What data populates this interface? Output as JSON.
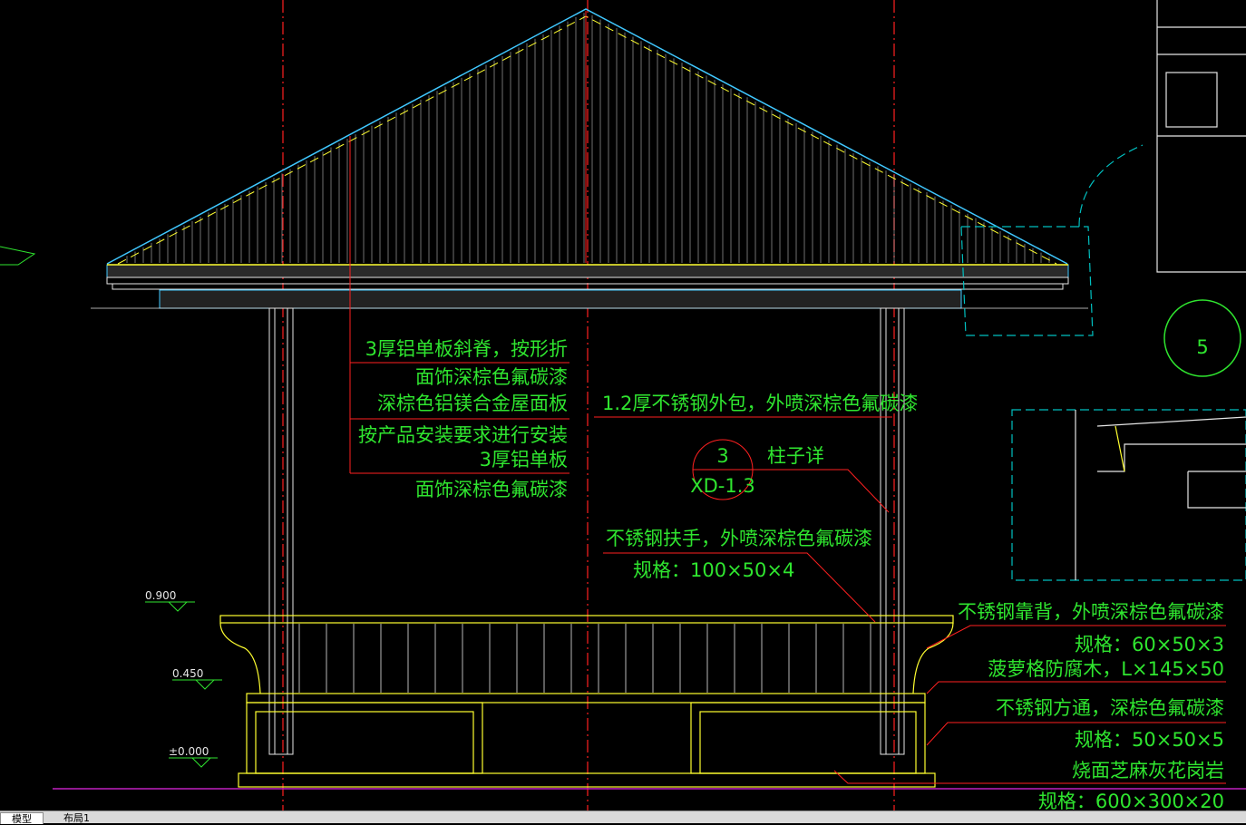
{
  "drawing": {
    "notes_left": [
      "3厚铝单板斜脊，按形折",
      "面饰深棕色氟碳漆",
      "深棕色铝镁合金屋面板",
      "按产品安装要求进行安装",
      "3厚铝单板",
      "面饰深棕色氟碳漆"
    ],
    "note_column": "1.2厚不锈钢外包，外喷深棕色氟碳漆",
    "detail_number": "3",
    "detail_sheet": "XD-1.3",
    "detail_label": "柱子详",
    "handrail_note": "不锈钢扶手，外喷深棕色氟碳漆",
    "handrail_spec": "规格：100×50×4",
    "notes_right": [
      "不锈钢靠背，外喷深棕色氟碳漆",
      "规格：60×50×3",
      "菠萝格防腐木，L×145×50",
      "不锈钢方通，深棕色氟碳漆",
      "规格：50×50×5",
      "烧面芝麻灰花岗岩",
      "规格：600×300×20"
    ],
    "levels": [
      "0.900",
      "0.450",
      "±0.000"
    ],
    "side_circle_number": "5"
  },
  "tabs": [
    "模型",
    "布局1"
  ],
  "colors": {
    "background": "#000000",
    "notes": "#2fe52f",
    "axis": "#ff2020",
    "structure": "#ffff30",
    "roof_edge": "#40c8ff",
    "ground": "#c020c0",
    "side_detail": "#00c0c0"
  }
}
